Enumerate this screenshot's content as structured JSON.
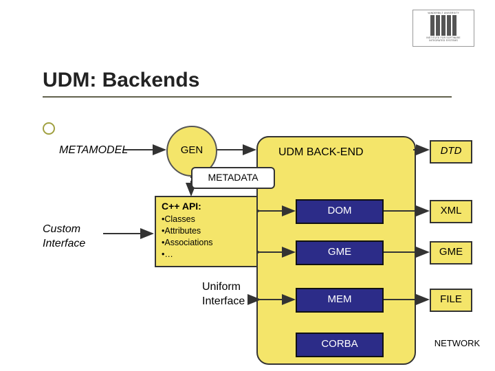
{
  "title": "UDM: Backends",
  "logo": {
    "top": "VANDERBILT UNIVERSITY",
    "bottom_l1": "INSTITUTE FOR SOFTWARE",
    "bottom_l2": "INTEGRATED SYSTEMS"
  },
  "labels": {
    "metamodel": "METAMODEL",
    "custom": "Custom\nInterface",
    "uniform": "Uniform\nInterface"
  },
  "gen": "GEN",
  "backend_title": "UDM BACK-END",
  "metadata": "METADATA",
  "dtd": "DTD",
  "api": {
    "title": "C++ API:",
    "items": [
      "•Classes",
      "•Attributes",
      "•Associations",
      "•…"
    ]
  },
  "rows": [
    {
      "blue": "DOM",
      "right": "XML"
    },
    {
      "blue": "GME",
      "right": "GME"
    },
    {
      "blue": "MEM",
      "right": "FILE"
    },
    {
      "blue": "CORBA",
      "right": "NETWORK"
    }
  ]
}
